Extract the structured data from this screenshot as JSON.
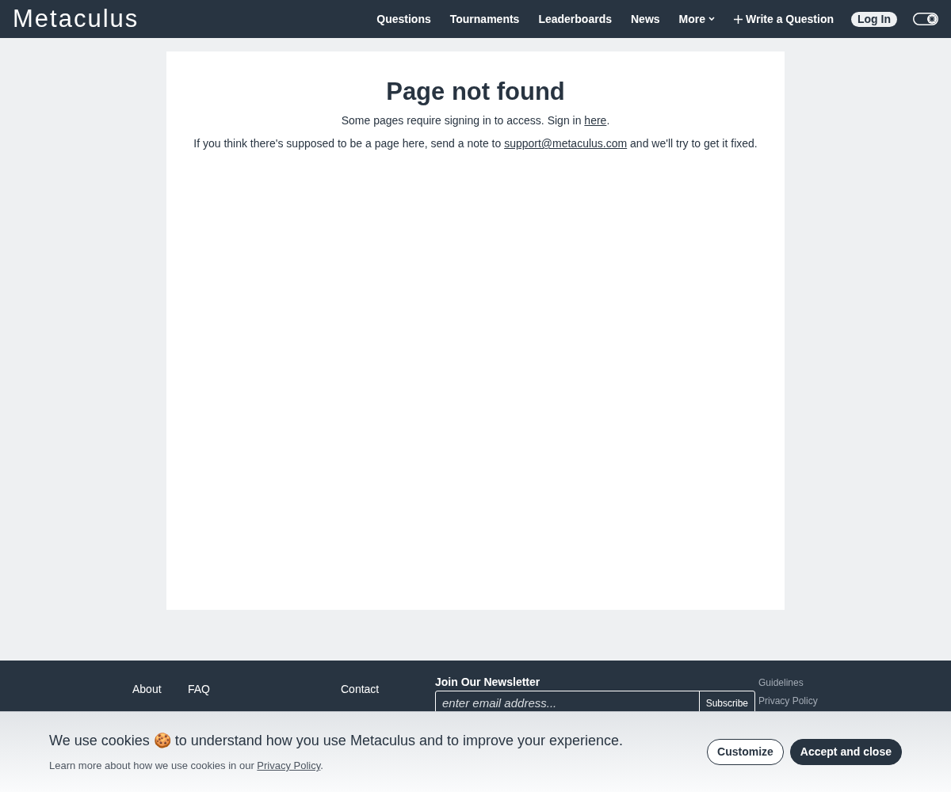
{
  "navbar": {
    "logo": "Metaculus",
    "links": [
      {
        "label": "Questions",
        "kind": "link"
      },
      {
        "label": "Tournaments",
        "kind": "link"
      },
      {
        "label": "Leaderboards",
        "kind": "link"
      },
      {
        "label": "News",
        "kind": "link"
      },
      {
        "label": "More",
        "kind": "dropdown"
      },
      {
        "label": "Write a Question",
        "kind": "create"
      }
    ],
    "login": "Log In",
    "theme_toggle": {
      "on": false
    }
  },
  "main": {
    "title": "Page not found",
    "lines": [
      {
        "before": "Some pages require signing in to access. Sign in ",
        "link": "here",
        "after": "."
      },
      {
        "before": "If you think there's supposed to be a page here, send a note to ",
        "link": "support@metaculus.com",
        "after": " and we'll try to get it fixed."
      }
    ]
  },
  "footer": {
    "columns": [
      [
        "About"
      ],
      [
        "FAQ"
      ],
      [
        "Contact"
      ]
    ],
    "newsletter": {
      "title": "Join Our Newsletter",
      "placeholder": "enter email address...",
      "button": "Subscribe"
    },
    "links": [
      "Guidelines",
      "Privacy Policy"
    ]
  },
  "cookie_banner": {
    "message": "We use cookies 🍪 to understand how you use Metaculus and to improve your experience.",
    "note_before": "Learn more about how we use cookies in our ",
    "note_link": "Privacy Policy",
    "note_after": ".",
    "buttons": [
      {
        "label": "Customize",
        "kind": "outline"
      },
      {
        "label": "Accept and close",
        "kind": "primary"
      }
    ]
  }
}
